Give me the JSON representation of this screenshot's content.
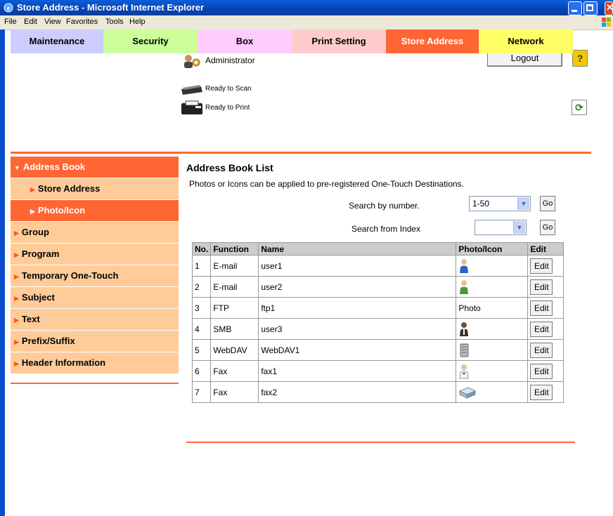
{
  "window": {
    "title": "Store Address - Microsoft Internet Explorer"
  },
  "menu": [
    "File",
    "Edit",
    "View",
    "Favorites",
    "Tools",
    "Help"
  ],
  "header": {
    "user": "Administrator",
    "logout_label": "Logout",
    "help_label": "?",
    "scan_status": "Ready to Scan",
    "print_status": "Ready to Print"
  },
  "tabs": [
    {
      "label": "Maintenance",
      "color": "#ccccff"
    },
    {
      "label": "Security",
      "color": "#ccff99"
    },
    {
      "label": "Box",
      "color": "#ffccff"
    },
    {
      "label": "Print Setting",
      "color": "#ffcccc"
    },
    {
      "label": "Store Address",
      "color": "#ff6633",
      "active": true
    },
    {
      "label": "Network",
      "color": "#ffff66"
    }
  ],
  "sidebar": {
    "items": [
      {
        "label": "Address Book",
        "active": true,
        "expanded": true
      },
      {
        "label": "Store Address",
        "sub": true
      },
      {
        "label": "Photo/Icon",
        "sub": true,
        "active": true
      },
      {
        "label": "Group"
      },
      {
        "label": "Program"
      },
      {
        "label": "Temporary One-Touch"
      },
      {
        "label": "Subject"
      },
      {
        "label": "Text"
      },
      {
        "label": "Prefix/Suffix"
      },
      {
        "label": "Header Information"
      }
    ]
  },
  "main": {
    "title": "Address Book List",
    "description": "Photos or Icons can be applied to pre-registered One-Touch Destinations.",
    "search_number_label": "Search by number.",
    "search_number_value": "1-50",
    "search_index_label": "Search from Index",
    "search_index_value": "",
    "go_label": "Go",
    "table": {
      "headers": [
        "No.",
        "Function",
        "Name",
        "Photo/Icon",
        "Edit"
      ],
      "rows": [
        {
          "no": "1",
          "function": "E-mail",
          "name": "user1",
          "photo": "person-blue-icon",
          "edit": "Edit"
        },
        {
          "no": "2",
          "function": "E-mail",
          "name": "user2",
          "photo": "person-green-icon",
          "edit": "Edit"
        },
        {
          "no": "3",
          "function": "FTP",
          "name": "ftp1",
          "photo": "Photo",
          "edit": "Edit"
        },
        {
          "no": "4",
          "function": "SMB",
          "name": "user3",
          "photo": "person-suit-icon",
          "edit": "Edit"
        },
        {
          "no": "5",
          "function": "WebDAV",
          "name": "WebDAV1",
          "photo": "server-icon",
          "edit": "Edit"
        },
        {
          "no": "6",
          "function": "Fax",
          "name": "fax1",
          "photo": "doctor-icon",
          "edit": "Edit"
        },
        {
          "no": "7",
          "function": "Fax",
          "name": "fax2",
          "photo": "fax-machine-icon",
          "edit": "Edit"
        }
      ]
    }
  },
  "colors": {
    "accent": "#ff6633",
    "sidebar_bg": "#ffcc99",
    "table_header": "#cccccc"
  }
}
